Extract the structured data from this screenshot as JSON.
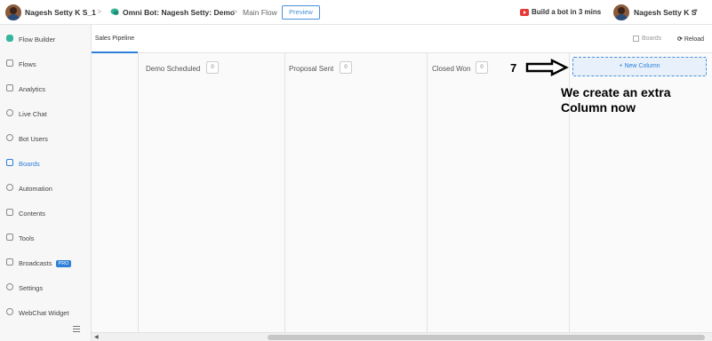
{
  "topbar": {
    "workspace": "Nagesh Setty K S_1",
    "bot_name": "Omni Bot: Nagesh Setty: Demo",
    "flow": "Main Flow",
    "preview_label": "Preview",
    "tutorial_link": "Build a bot in 3 mins",
    "user_name": "Nagesh Setty K S",
    "separator": ">"
  },
  "sidebar": {
    "items": [
      {
        "label": "Flow Builder",
        "icon": "chat-bubble-icon"
      },
      {
        "label": "Flows",
        "icon": "grid-icon"
      },
      {
        "label": "Analytics",
        "icon": "chart-icon"
      },
      {
        "label": "Live Chat",
        "icon": "headset-icon"
      },
      {
        "label": "Bot Users",
        "icon": "user-icon"
      },
      {
        "label": "Boards",
        "icon": "board-icon",
        "active": true
      },
      {
        "label": "Automation",
        "icon": "automation-icon"
      },
      {
        "label": "Contents",
        "icon": "contents-icon"
      },
      {
        "label": "Tools",
        "icon": "tools-icon"
      },
      {
        "label": "Broadcasts",
        "icon": "megaphone-icon",
        "badge": "PRO"
      },
      {
        "label": "Settings",
        "icon": "gear-icon"
      },
      {
        "label": "WebChat Widget",
        "icon": "widget-icon"
      }
    ]
  },
  "main": {
    "tab": "Sales Pipeline",
    "boards_link": "Boards",
    "reload_label": "Reload"
  },
  "board": {
    "columns": [
      {
        "title": "Demo Scheduled",
        "count": "0"
      },
      {
        "title": "Proposal Sent",
        "count": "0"
      },
      {
        "title": "Closed Won",
        "count": "0"
      }
    ],
    "new_column_label": "+ New Column"
  },
  "annotation": {
    "step": "7",
    "text": "We create an extra Column now"
  },
  "colors": {
    "accent": "#2d7fd8",
    "sidebar_bg": "#f7f7f7",
    "board_bg": "#fafafa"
  }
}
